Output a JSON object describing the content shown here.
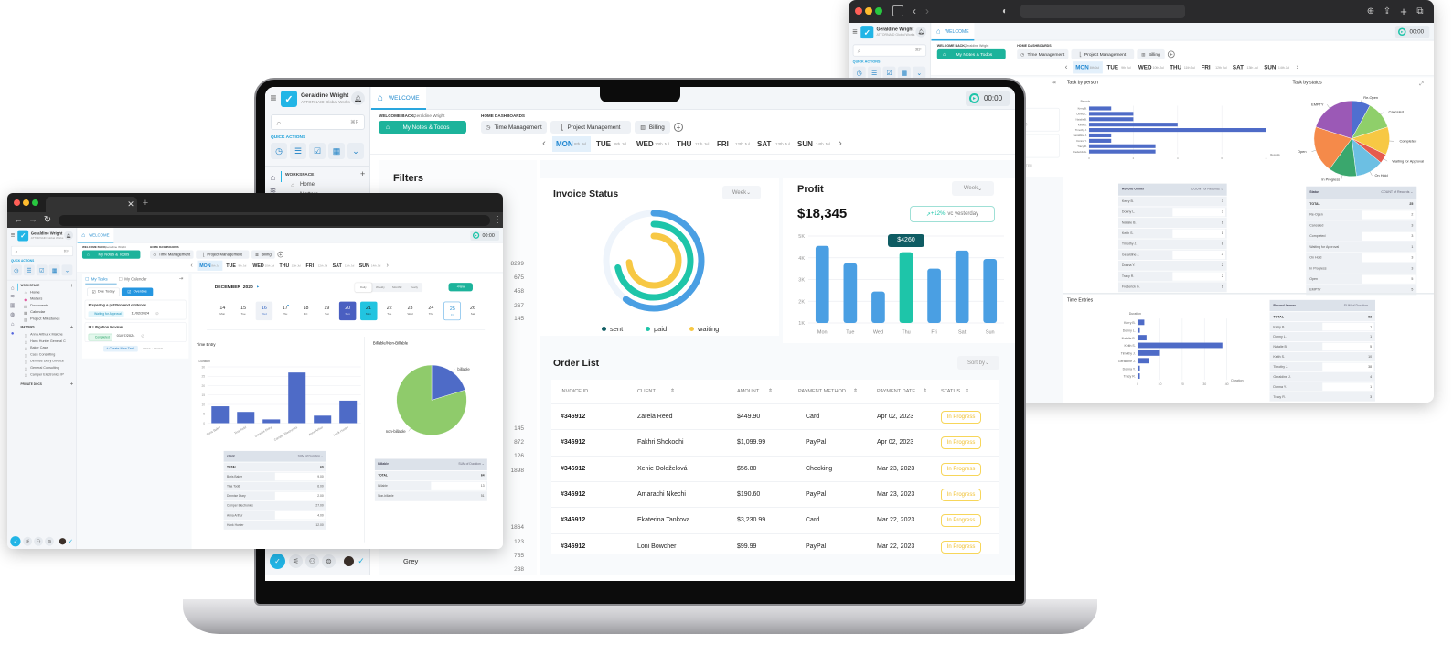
{
  "colors": {
    "brand": "#22b5e6",
    "teal_button": "#1cb39b",
    "bar_blue": "#4a9fe3",
    "bar_highlight": "#1ec5a9",
    "chart_blue": "#4e6bc7",
    "pie_green": "#8fcb6b",
    "status_yellow": "#f7c844"
  },
  "app": {
    "user_name": "Geraldine Wright",
    "org": "ATTORNAID Global Works",
    "welcome_tab": "WELCOME",
    "timer": "00:00",
    "search_shortcut": "⌘F",
    "quick_actions_label": "QUICK ACTIONS",
    "welcome_back_label": "WELCOME BACK,",
    "welcome_back_name": "Geraldine Wright",
    "my_notes_button": "My Notes & Todos",
    "home_dashboards_label": "HOME DASHBOARDS",
    "dashboards": [
      "Time Management",
      "Project Management",
      "Billing"
    ],
    "days": [
      {
        "d": "MON",
        "date": "8th Jul"
      },
      {
        "d": "TUE",
        "date": "9th Jul"
      },
      {
        "d": "WED",
        "date": "10th Jul"
      },
      {
        "d": "THU",
        "date": "11th Jul"
      },
      {
        "d": "FRI",
        "date": "12th Jul"
      },
      {
        "d": "SAT",
        "date": "13th Jul"
      },
      {
        "d": "SUN",
        "date": "14th Jul"
      }
    ],
    "selected_day": "MON",
    "workspace_label": "WORKSPACE",
    "workspace_items": [
      "Home",
      "Matters",
      "Documents",
      "Calendar",
      "Project Milestones"
    ],
    "matters_label": "MATTERS",
    "matters": [
      "Anna Arthur x Malone",
      "Hank Hunter General C",
      "Baker Case",
      "Case Consulting",
      "Dennise Diary Divorce",
      "General Consulting",
      "Camper Electronics IP"
    ],
    "private_docs_label": "PRIVATE DOCS"
  },
  "tasks": {
    "tabs": [
      "My Tasks",
      "My Calendar"
    ],
    "filters": [
      "Due Today",
      "Overdue"
    ],
    "items": [
      {
        "title": "Preparing a petition and evidence",
        "status": "Waiting for Approval",
        "date": "11/02/2024"
      },
      {
        "title": "IP Litigation Review",
        "status": "Completed",
        "date": "01/07/2024"
      }
    ],
    "create_button": "+ Create New Task",
    "create_shortcut": "SHIFT + ENTER"
  },
  "laptop": {
    "filters_title": "Filters",
    "filter_values": [
      "8299",
      "675",
      "458",
      "267",
      "145",
      "145",
      "872",
      "126",
      "1898",
      "1864",
      "123",
      "755",
      "238"
    ],
    "filter_color": "Grey",
    "invoice_status": {
      "title": "Invoice Status",
      "period": "Week"
    },
    "profit": {
      "title": "Profit",
      "period": "Week",
      "total": "$18,345",
      "change": "+12%",
      "change_label": "vc yesterday",
      "tooltip": "$4260"
    },
    "order_list": {
      "title": "Order List",
      "sort_label": "Sort by",
      "columns": [
        "INVOICE ID",
        "CLIENT",
        "AMOUNT",
        "PAYMENT METHOD",
        "PAYMENT DATE",
        "STATUS"
      ],
      "rows": [
        [
          "#346912",
          "Zarela Reed",
          "$449.90",
          "Card",
          "Apr 02, 2023",
          "In Progress"
        ],
        [
          "#346912",
          "Fakhri Shokoohi",
          "$1,099.99",
          "PayPal",
          "Apr 02, 2023",
          "In Progress"
        ],
        [
          "#346912",
          "Xenie Doleželová",
          "$56.80",
          "Checking",
          "Mar 23, 2023",
          "In Progress"
        ],
        [
          "#346912",
          "Amarachi Nkechi",
          "$190.60",
          "PayPal",
          "Mar 23, 2023",
          "In Progress"
        ],
        [
          "#346912",
          "Ekaterina Tankova",
          "$3,230.99",
          "Card",
          "Mar 22, 2023",
          "In Progress"
        ],
        [
          "#346912",
          "Loni Bowcher",
          "$99.99",
          "PayPal",
          "Mar 22, 2023",
          "In Progress"
        ]
      ]
    }
  },
  "left_window": {
    "calendar": {
      "month": "DECEMBER",
      "year": "2020",
      "views": [
        "Daily",
        "Weekly",
        "Monthly",
        "Yearly"
      ],
      "selected_view": "Daily",
      "new_button": "+New",
      "dates": [
        {
          "n": "14",
          "d": "Mon"
        },
        {
          "n": "15",
          "d": "Tue"
        },
        {
          "n": "16",
          "d": "Wed",
          "state": "today"
        },
        {
          "n": "17",
          "d": "Thu",
          "state": "dot"
        },
        {
          "n": "18",
          "d": "Fri"
        },
        {
          "n": "19",
          "d": "Sat"
        },
        {
          "n": "20",
          "d": "Sun",
          "state": "selected"
        },
        {
          "n": "21",
          "d": "Mon",
          "state": "active"
        },
        {
          "n": "22",
          "d": "Tue"
        },
        {
          "n": "23",
          "d": "Wed"
        },
        {
          "n": "24",
          "d": "Thu"
        },
        {
          "n": "25",
          "d": "Fri",
          "state": "outlined"
        },
        {
          "n": "26",
          "d": "Sat"
        }
      ]
    },
    "time_entry_table": {
      "headers": [
        "client",
        "SUM of Duration ⌄"
      ],
      "rows": [
        [
          "TOTAL",
          "60"
        ],
        [
          "Boris Baker",
          "9.00"
        ],
        [
          "Tina Todd",
          "6.00"
        ],
        [
          "Dennise Diary",
          "2.00"
        ],
        [
          "Camper Electronics",
          "27.00"
        ],
        [
          "Anna Arthur",
          "4.00"
        ],
        [
          "Hank Hunter",
          "12.00"
        ]
      ]
    },
    "billable_table": {
      "headers": [
        "Billable",
        "SUM of Duration ⌄"
      ],
      "rows": [
        [
          "TOTAL",
          "64"
        ],
        [
          "Billable",
          "13"
        ],
        [
          "Non-billable",
          "51"
        ]
      ]
    }
  },
  "right_window": {
    "person_table": {
      "headers": [
        "Record Owner",
        "COUNT of Records ⌄"
      ],
      "rows": [
        [
          "Kerry B.",
          "3"
        ],
        [
          "Donny L.",
          "3"
        ],
        [
          "Natalie B.",
          "1"
        ],
        [
          "Keith S.",
          "1"
        ],
        [
          "Timothy J.",
          "8"
        ],
        [
          "Geraldine J.",
          "4"
        ],
        [
          "Donna Y.",
          "2"
        ],
        [
          "Tracy R.",
          "2"
        ],
        [
          "Frederick G.",
          "1"
        ]
      ]
    },
    "status_table": {
      "headers": [
        "Status",
        "COUNT of Records ⌄"
      ],
      "rows": [
        [
          "TOTAL",
          "25"
        ],
        [
          "Re-Open",
          "2"
        ],
        [
          "Canceled",
          "3"
        ],
        [
          "Completed",
          "3"
        ],
        [
          "Waiting for Approval",
          "1"
        ],
        [
          "On Hold",
          "3"
        ],
        [
          "In Progress",
          "3"
        ],
        [
          "Open",
          "5"
        ],
        [
          "EMPTY",
          "5"
        ]
      ]
    },
    "time_entries_table": {
      "headers": [
        "Record Owner",
        "SUM of Duration ⌄"
      ],
      "rows": [
        [
          "TOTAL",
          "63"
        ],
        [
          "Kerry B.",
          "1"
        ],
        [
          "Donny L.",
          "1"
        ],
        [
          "Natalie B.",
          "5"
        ],
        [
          "Keith S.",
          "10"
        ],
        [
          "Timothy J.",
          "38"
        ],
        [
          "Geraldine J.",
          "4"
        ],
        [
          "Donna Y.",
          "1"
        ],
        [
          "Tracy R.",
          "3"
        ]
      ]
    }
  },
  "chart_data": [
    {
      "id": "invoice",
      "type": "radial-bar",
      "title": "Invoice Status",
      "series": [
        {
          "name": "sent",
          "value": 0.6,
          "color": "#4a9fe3",
          "legend_color": "#0f5c63"
        },
        {
          "name": "paid",
          "value": 0.72,
          "color": "#1ec5a9",
          "legend_color": "#1ec5a9"
        },
        {
          "name": "waiting",
          "value": 0.74,
          "color": "#f7c844",
          "legend_color": "#f7c844"
        }
      ]
    },
    {
      "id": "profit",
      "type": "bar",
      "title": "Profit",
      "categories": [
        "Mon",
        "Tue",
        "Wed",
        "Thu",
        "Fri",
        "Sat",
        "Sun"
      ],
      "values": [
        4550,
        3750,
        2450,
        4260,
        3500,
        4330,
        3950
      ],
      "highlight": "Thu",
      "yticks": [
        "1K",
        "2K",
        "3K",
        "4K",
        "5K"
      ],
      "ylim": [
        1000,
        5000
      ],
      "grid": true
    },
    {
      "id": "time_entry",
      "type": "bar",
      "title": "Time Entry",
      "ylabel": "Duration",
      "categories": [
        "Boris Baker",
        "Tina Todd",
        "Dennise Diary",
        "Camper Electronics",
        "Anna Arthur",
        "Hank Hunter"
      ],
      "values": [
        9,
        6,
        2,
        27,
        4,
        12
      ],
      "yticks": [
        "0",
        "5",
        "10",
        "15",
        "20",
        "25",
        "30"
      ],
      "ylim": [
        0,
        30
      ],
      "grid": true
    },
    {
      "id": "billable",
      "type": "pie",
      "title": "Billable/Non-Billable",
      "labels": [
        "billable",
        "non-billable"
      ],
      "values": [
        13,
        51
      ],
      "colors": [
        "#4e6bc7",
        "#8fcb6b"
      ]
    },
    {
      "id": "task_person",
      "type": "hbar",
      "title": "Task by person",
      "ylabel": "Records",
      "xlabel": "Records",
      "categories": [
        "Kerry B.",
        "Donny L.",
        "Natalie B.",
        "Keith S.",
        "Timothy J.",
        "Geraldine J.",
        "Donna Y.",
        "Tracy R.",
        "Frederick G."
      ],
      "values": [
        1,
        2,
        2,
        4,
        8,
        1,
        1,
        3,
        3
      ],
      "xticks": [
        "0",
        "2",
        "4",
        "6",
        "8"
      ],
      "xlim": [
        0,
        8
      ],
      "grid": true
    },
    {
      "id": "task_status",
      "type": "pie",
      "title": "Task by status",
      "labels": [
        "Re-Open",
        "Canceled",
        "Completed",
        "Waiting for Approval",
        "On Hold",
        "In Progress",
        "Open",
        "EMPTY"
      ],
      "values": [
        2,
        3,
        3,
        1,
        3,
        3,
        5,
        5
      ],
      "colors": [
        "#4f6fd0",
        "#8fcf6a",
        "#f7c844",
        "#e55a4e",
        "#6cbfe3",
        "#3aa76d",
        "#f58a4a",
        "#9b59b6"
      ]
    },
    {
      "id": "time_entries",
      "type": "hbar",
      "title": "Time Entries",
      "ylabel": "Duration",
      "xlabel": "Duration",
      "categories": [
        "Kerry B.",
        "Donny L.",
        "Natalie B.",
        "Keith S.",
        "Timothy J.",
        "Geraldine J.",
        "Donna Y.",
        "Tracy R."
      ],
      "values": [
        3,
        1,
        4,
        38,
        10,
        5,
        1,
        1
      ],
      "xticks": [
        "0",
        "10",
        "20",
        "30",
        "40"
      ],
      "xlim": [
        0,
        40
      ],
      "grid": true
    }
  ]
}
